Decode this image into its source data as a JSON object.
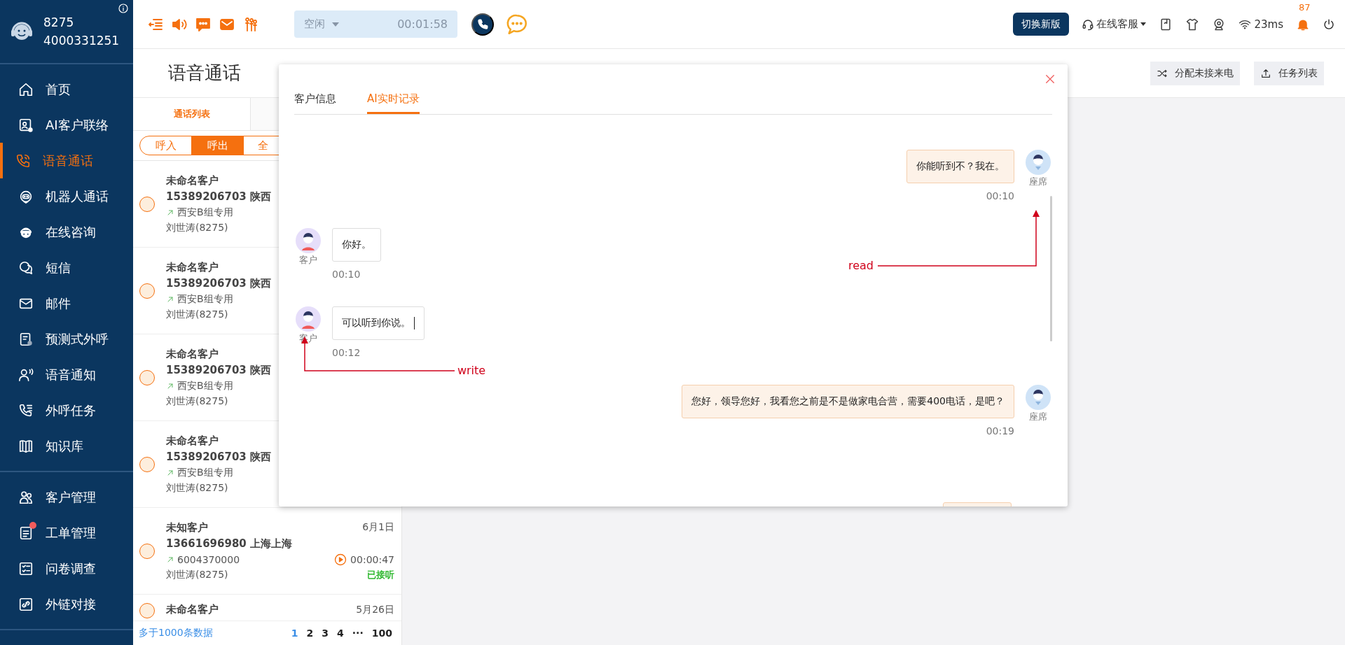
{
  "sidebar": {
    "extension": "8275",
    "number": "4000331251",
    "sections": [
      {
        "items": [
          {
            "label": "首页",
            "selected": false,
            "badge": false
          },
          {
            "label": "AI客户联络",
            "selected": false,
            "badge": false
          },
          {
            "label": "语音通话",
            "selected": true,
            "badge": false
          },
          {
            "label": "机器人通话",
            "selected": false,
            "badge": false
          },
          {
            "label": "在线咨询",
            "selected": false,
            "badge": false
          },
          {
            "label": "短信",
            "selected": false,
            "badge": false
          },
          {
            "label": "邮件",
            "selected": false,
            "badge": false
          },
          {
            "label": "预测式外呼",
            "selected": false,
            "badge": false
          },
          {
            "label": "语音通知",
            "selected": false,
            "badge": false
          },
          {
            "label": "外呼任务",
            "selected": false,
            "badge": false
          },
          {
            "label": "知识库",
            "selected": false,
            "badge": false
          }
        ]
      },
      {
        "items": [
          {
            "label": "客户管理",
            "selected": false,
            "badge": false
          },
          {
            "label": "工单管理",
            "selected": false,
            "badge": true
          },
          {
            "label": "问卷调查",
            "selected": false,
            "badge": false
          },
          {
            "label": "外链对接",
            "selected": false,
            "badge": false
          }
        ]
      }
    ]
  },
  "toolbar": {
    "status": {
      "value": "空闲",
      "timer": "00:01:58"
    }
  },
  "top_right": {
    "switch_button": "切换新版",
    "service": "在线客服",
    "latency": "23ms",
    "notifications": "87"
  },
  "page": {
    "title": "语音通话",
    "actions": [
      "分配未接来电",
      "任务列表"
    ]
  },
  "call_list": {
    "tabs": [
      {
        "label": "通话列表",
        "selected": true
      }
    ],
    "filters": [
      {
        "label": "呼入",
        "selected": false
      },
      {
        "label": "呼出",
        "selected": true
      },
      {
        "label": "全",
        "selected": false
      }
    ],
    "items": [
      {
        "name": "未命名客户",
        "phone": "15389206703 陕西",
        "line": "西安B组专用",
        "agent": "刘世涛(8275)",
        "checked": false
      },
      {
        "name": "未命名客户",
        "phone": "15389206703 陕西",
        "line": "西安B组专用",
        "agent": "刘世涛(8275)",
        "checked": false
      },
      {
        "name": "未命名客户",
        "phone": "15389206703 陕西",
        "line": "西安B组专用",
        "agent": "刘世涛(8275)",
        "checked": false
      },
      {
        "name": "未命名客户",
        "phone": "15389206703 陕西",
        "line": "西安B组专用",
        "agent": "刘世涛(8275)",
        "checked": false
      },
      {
        "name": "未知客户",
        "date": "6月1日",
        "phone": "13661696980 上海上海",
        "line": "6004370000",
        "duration": "00:00:47",
        "agent": "刘世涛(8275)",
        "status": "已接听",
        "checked": false
      },
      {
        "name": "未命名客户",
        "date": "5月26日",
        "checked": false
      }
    ],
    "pagination": {
      "summary": "多于1000条数据",
      "pages": [
        {
          "label": "1",
          "selected": true
        },
        {
          "label": "2",
          "selected": false
        },
        {
          "label": "3",
          "selected": false
        },
        {
          "label": "4",
          "selected": false
        },
        {
          "label": "···",
          "selected": false
        },
        {
          "label": "100",
          "selected": false
        }
      ]
    }
  },
  "dialog": {
    "tabs": [
      {
        "label": "客户信息",
        "selected": false
      },
      {
        "label": "AI实时记录",
        "selected": true
      }
    ],
    "messages": [
      {
        "kind": "agent",
        "speaker": "座席",
        "text": "你能听到不？我在。",
        "time": "00:10",
        "cursor": false
      },
      {
        "kind": "customer",
        "speaker": "客户",
        "text": "你好。",
        "time": "00:10",
        "cursor": false
      },
      {
        "kind": "customer",
        "speaker": "客户",
        "text": "可以听到你说。",
        "time": "00:12",
        "cursor": true
      },
      {
        "kind": "agent",
        "speaker": "座席",
        "text": "您好，领导您好，我看您之前是不是做家电合营，需要400电话，是吧？",
        "time": "00:19",
        "cursor": false
      }
    ],
    "annotations": [
      {
        "text": "read"
      },
      {
        "text": "write"
      }
    ]
  }
}
